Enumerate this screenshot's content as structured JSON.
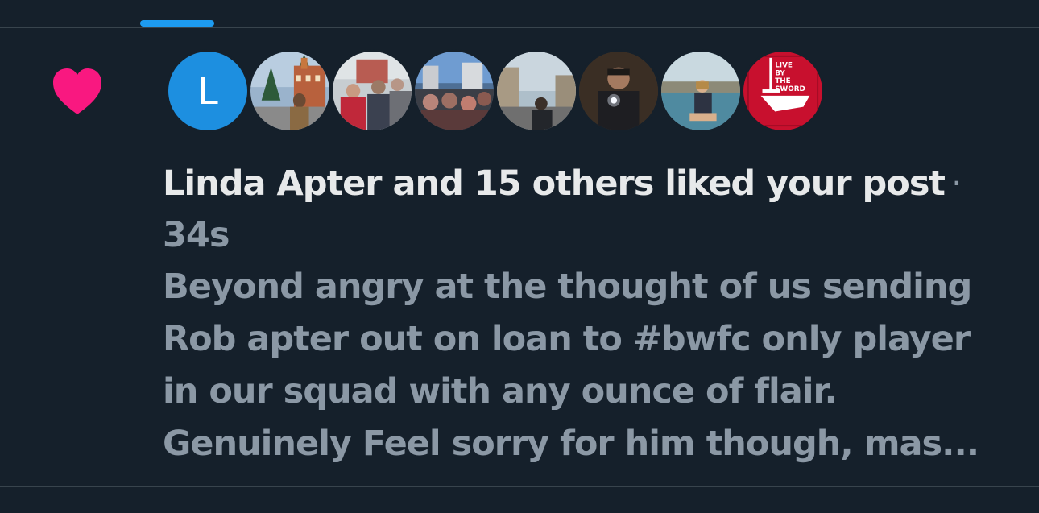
{
  "notification": {
    "type_icon": "heart-icon",
    "accent_color": "#f91880",
    "tab_indicator_color": "#1d9bf0",
    "avatars": [
      {
        "kind": "letter",
        "letter": "L",
        "color": "#1d8fe0"
      },
      {
        "kind": "photo",
        "description": "old-town-square-photo"
      },
      {
        "kind": "photo",
        "description": "crowd-photo"
      },
      {
        "kind": "photo",
        "description": "street-crowd-photo"
      },
      {
        "kind": "photo",
        "description": "city-street-photo"
      },
      {
        "kind": "photo",
        "description": "man-with-phone-photo"
      },
      {
        "kind": "photo",
        "description": "woman-by-pool-photo"
      },
      {
        "kind": "logo",
        "text": [
          "LIVE",
          "BY",
          "THE",
          "SWORD"
        ],
        "color": "#c8102e"
      }
    ],
    "headline": "Linda Apter and 15 others liked your post",
    "separator": "·",
    "timestamp": "34s",
    "post_lines": [
      "Beyond angry at the thought of us sending",
      "Rob apter out on loan to #bwfc only player",
      "in our squad with any ounce of flair.",
      "Genuinely Feel sorry for him though, mas..."
    ]
  }
}
